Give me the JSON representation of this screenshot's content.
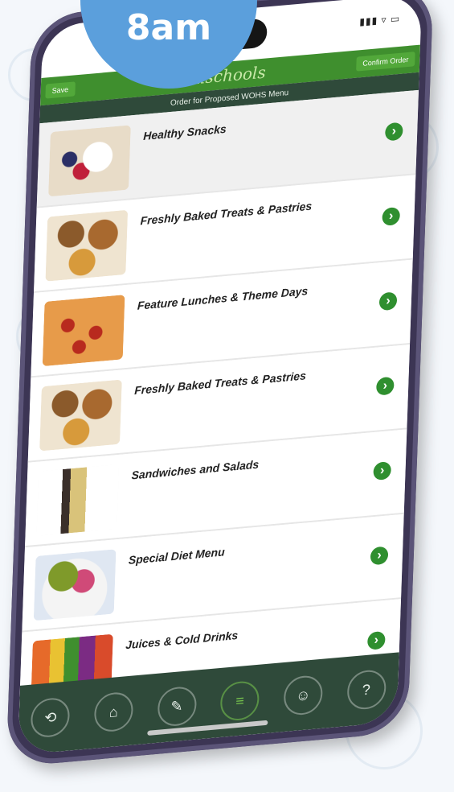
{
  "badge": {
    "text": "8am"
  },
  "app": {
    "brand": "Flexischools",
    "top_left_button": "Save",
    "top_right_button": "Confirm Order",
    "subtitle": "Order for Proposed WOHS Menu",
    "status": "▮▮▮ ▿ ▭"
  },
  "menu_items": [
    {
      "label": "Healthy Snacks"
    },
    {
      "label": "Freshly Baked Treats & Pastries"
    },
    {
      "label": "Feature Lunches & Theme Days"
    },
    {
      "label": "Freshly Baked Treats & Pastries"
    },
    {
      "label": "Sandwiches and Salads"
    },
    {
      "label": "Special Diet Menu"
    },
    {
      "label": "Juices & Cold Drinks"
    }
  ],
  "icons": {
    "chevron": "›",
    "nav": [
      "back-icon",
      "home-icon",
      "notifications-icon",
      "menu-icon",
      "profile-icon",
      "help-icon"
    ]
  },
  "nav_glyphs": [
    "⟲",
    "⌂",
    "✎",
    "≡",
    "☺",
    "?"
  ]
}
